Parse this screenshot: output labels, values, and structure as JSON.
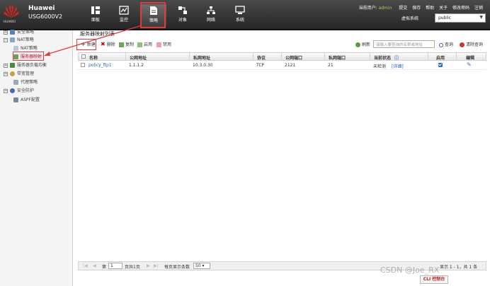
{
  "header": {
    "brand_name": "Huawei",
    "model": "USG6000V2",
    "logo_text": "HUAWEI",
    "nav": [
      {
        "label": "面板",
        "icon": "dashboard-icon"
      },
      {
        "label": "监控",
        "icon": "monitor-icon"
      },
      {
        "label": "策略",
        "icon": "policy-document-icon"
      },
      {
        "label": "对象",
        "icon": "object-icon"
      },
      {
        "label": "网络",
        "icon": "network-icon"
      },
      {
        "label": "系统",
        "icon": "system-icon"
      }
    ],
    "active_nav": "策略",
    "current_user_label": "当前用户:",
    "current_user": "admin",
    "links": [
      "提交",
      "保存",
      "帮助",
      "关于",
      "修改密码",
      "注销"
    ],
    "vsys_label": "虚拟系统",
    "vsys_value": "public"
  },
  "sidebar": {
    "items": [
      {
        "label": "安全策略",
        "level": 0,
        "expand": "+"
      },
      {
        "label": "NAT策略",
        "level": 0,
        "expand": "-"
      },
      {
        "label": "NAT策略",
        "level": 1
      },
      {
        "label": "服务器映射",
        "level": 1,
        "selected": true
      },
      {
        "label": "服务器负载均衡",
        "level": 0,
        "expand": "+"
      },
      {
        "label": "带宽管理",
        "level": 0,
        "expand": "+"
      },
      {
        "label": "代理策略",
        "level": 1
      },
      {
        "label": "安全防护",
        "level": 0,
        "expand": "+"
      },
      {
        "label": "ASPF配置",
        "level": 1
      }
    ]
  },
  "main": {
    "title": "服务器映射列表",
    "toolbar": {
      "new": "新建",
      "delete": "删除",
      "copy": "复制",
      "enable": "启用",
      "disable": "禁用",
      "refresh": "刷新",
      "search_placeholder": "请输入要查询的名称或地址",
      "search": "查询",
      "clear_search": "清除查询"
    },
    "columns": [
      "名称",
      "公网地址",
      "私网地址",
      "协议",
      "公网端口",
      "私网端口",
      "当前状态",
      "启用",
      "编辑"
    ],
    "rows": [
      {
        "name": "policy_ftp1",
        "public_ip": "1.1.1.2",
        "private_ip": "10.3.0.30",
        "protocol": "TCP",
        "public_port": "2121",
        "private_port": "21",
        "status": "未检测",
        "status_link": "[详细]",
        "enabled": true
      }
    ],
    "pager": {
      "page_prefix": "第",
      "page_value": "1",
      "page_suffix": "页共1页",
      "per_page_label": "每页显示条数",
      "per_page_value": "50",
      "summary": "显示 1 - 1，共 1 条"
    }
  },
  "footer": {
    "cli_label": "CLI 控制台",
    "watermark": "CSDN @Joe_RX"
  },
  "colors": {
    "accent": "#e23b3b",
    "link": "#1f5fb8",
    "user": "#9fd24c"
  }
}
